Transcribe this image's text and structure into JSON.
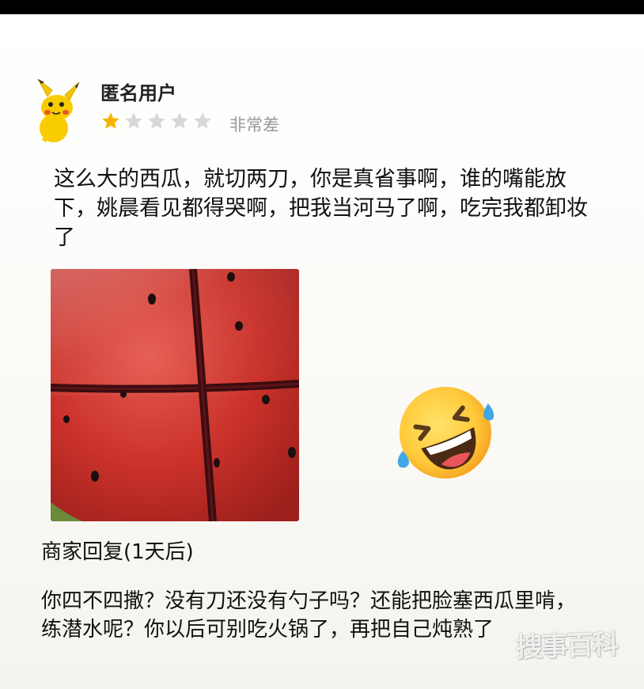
{
  "user": {
    "name": "匿名用户",
    "rating": 1,
    "rating_max": 5,
    "rating_text": "非常差"
  },
  "review": {
    "text": "这么大的西瓜，就切两刀，你是真省事啊，谁的嘴能放下，姚晨看见都得哭啊，把我当河马了啊，吃完我都卸妆了"
  },
  "photo": {
    "subject": "watermelon-cut-in-four"
  },
  "emoji": {
    "name": "rolling-on-floor-laughing-icon"
  },
  "reply": {
    "header": "商家回复(1天后)",
    "text": "你四不四撒？没有刀还没有勺子吗？还能把脸塞西瓜里啃，练潜水呢？你以后可别吃火锅了，再把自己炖熟了"
  },
  "watermark": {
    "text": "搜事百科"
  },
  "colors": {
    "star_on": "#f5b400",
    "star_off": "#d8d8d8",
    "muted": "#999999"
  }
}
